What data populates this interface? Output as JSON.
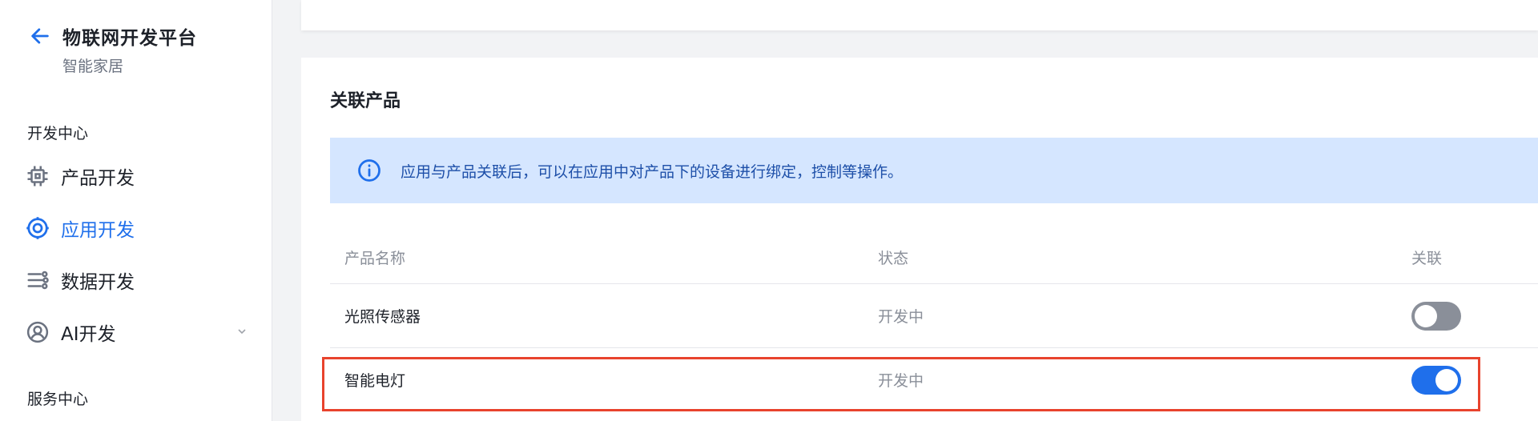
{
  "sidebar": {
    "title": "物联网开发平台",
    "subtitle": "智能家居",
    "group_dev": "开发中心",
    "items": [
      {
        "label": "产品开发",
        "icon": "chip-icon"
      },
      {
        "label": "应用开发",
        "icon": "app-ring-icon"
      },
      {
        "label": "数据开发",
        "icon": "data-flow-icon"
      },
      {
        "label": "AI开发",
        "icon": "ai-icon"
      }
    ],
    "group_service": "服务中心"
  },
  "main": {
    "card_title": "关联产品",
    "notice": "应用与产品关联后，可以在应用中对产品下的设备进行绑定，控制等操作。",
    "columns": [
      "产品名称",
      "状态",
      "关联"
    ],
    "rows": [
      {
        "name": "光照传感器",
        "status": "开发中",
        "linked": false
      },
      {
        "name": "智能电灯",
        "status": "开发中",
        "linked": true
      }
    ]
  },
  "colors": {
    "accent": "#1f6feb",
    "notice_bg": "#d5e6ff",
    "toggle_off": "#8a8f99",
    "highlight": "#e8432d"
  }
}
